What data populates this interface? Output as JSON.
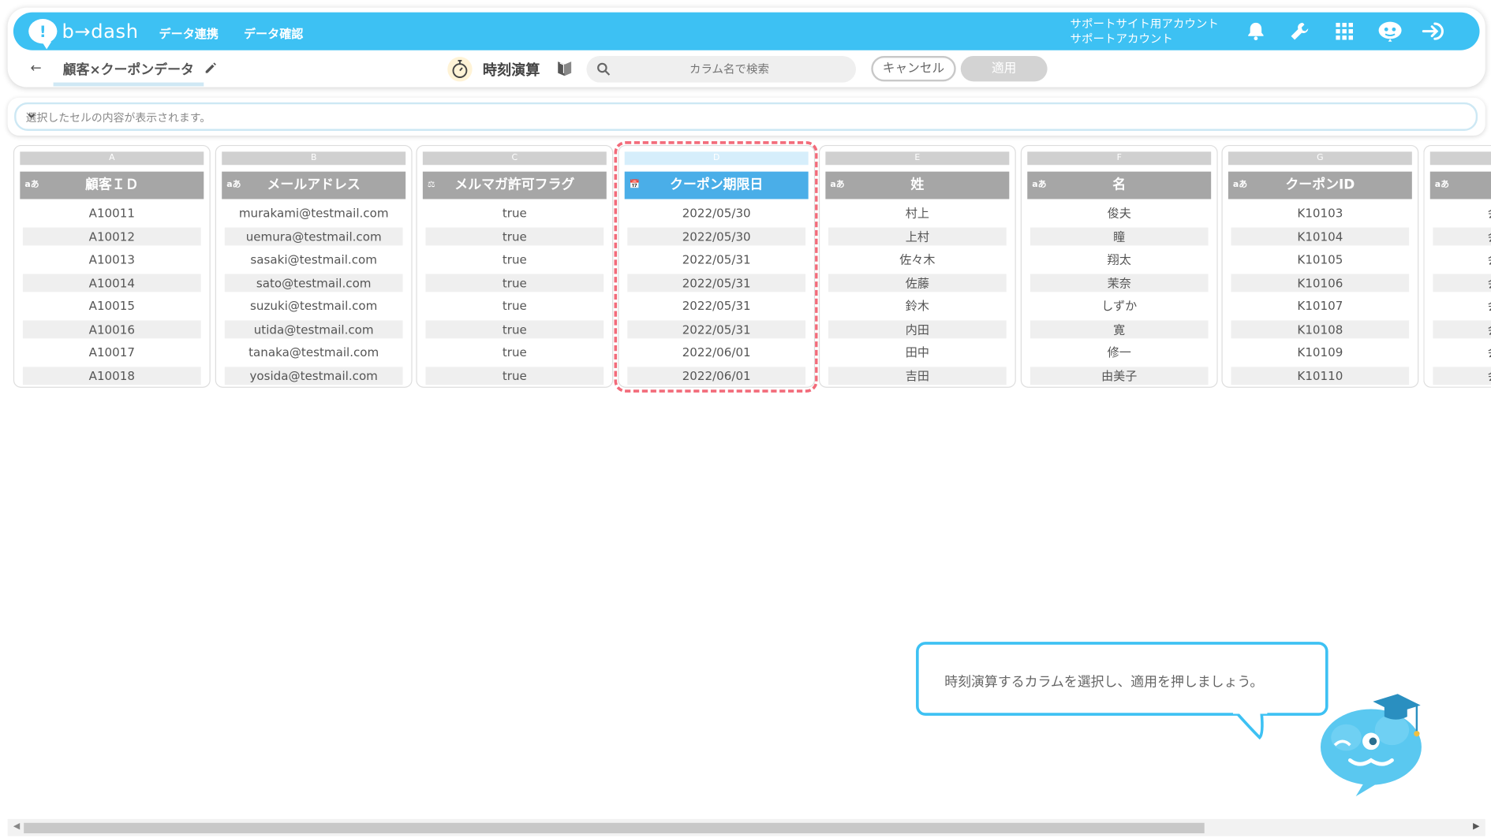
{
  "app": {
    "logo_mark": "!",
    "logo_text": "b→dash",
    "nav": [
      "データ連携",
      "データ確認"
    ],
    "account_line1": "サポートサイト用アカウント",
    "account_line2": "サポートアカウント",
    "icons": [
      "bell-icon",
      "wrench-icon",
      "grid-icon",
      "mascot-face-icon",
      "logout-icon"
    ]
  },
  "toolbar": {
    "back": "←",
    "dataset_name": "顧客×クーポンデータ",
    "operation_title": "時刻演算",
    "search_placeholder": "カラム名で検索",
    "cancel_label": "キャンセル",
    "apply_label": "適用"
  },
  "cell_preview": {
    "text": "選択したセルの内容が表示されます。"
  },
  "columns": [
    {
      "letter": "A",
      "type": "aあ",
      "name": "顧客ＩＤ",
      "selected": false,
      "values": [
        "A10011",
        "A10012",
        "A10013",
        "A10014",
        "A10015",
        "A10016",
        "A10017",
        "A10018"
      ]
    },
    {
      "letter": "B",
      "type": "aあ",
      "name": "メールアドレス",
      "selected": false,
      "values": [
        "murakami@testmail.com",
        "uemura@testmail.com",
        "sasaki@testmail.com",
        "sato@testmail.com",
        "suzuki@testmail.com",
        "utida@testmail.com",
        "tanaka@testmail.com",
        "yosida@testmail.com"
      ]
    },
    {
      "letter": "C",
      "type": "⚖",
      "name": "メルマガ許可フラグ",
      "selected": false,
      "values": [
        "true",
        "true",
        "true",
        "true",
        "true",
        "true",
        "true",
        "true"
      ]
    },
    {
      "letter": "D",
      "type": "📅",
      "name": "クーポン期限日",
      "selected": true,
      "values": [
        "2022/05/30",
        "2022/05/30",
        "2022/05/31",
        "2022/05/31",
        "2022/05/31",
        "2022/05/31",
        "2022/06/01",
        "2022/06/01"
      ]
    },
    {
      "letter": "E",
      "type": "aあ",
      "name": "姓",
      "selected": false,
      "values": [
        "村上",
        "上村",
        "佐々木",
        "佐藤",
        "鈴木",
        "内田",
        "田中",
        "吉田"
      ]
    },
    {
      "letter": "F",
      "type": "aあ",
      "name": "名",
      "selected": false,
      "values": [
        "俊夫",
        "瞳",
        "翔太",
        "茉奈",
        "しずか",
        "寛",
        "修一",
        "由美子"
      ]
    },
    {
      "letter": "G",
      "type": "aあ",
      "name": "クーポンID",
      "selected": false,
      "values": [
        "K10103",
        "K10104",
        "K10105",
        "K10106",
        "K10107",
        "K10108",
        "K10109",
        "K10110"
      ]
    },
    {
      "letter": "",
      "type": "aあ",
      "name": "",
      "selected": false,
      "values": [
        "会",
        "会",
        "会",
        "会",
        "会",
        "会",
        "会",
        "会"
      ]
    }
  ],
  "tooltip": {
    "text": "時刻演算するカラムを選択し、適用を押しましょう。"
  },
  "scrollbar": {
    "left_arrow": "◀",
    "right_arrow": "▶"
  },
  "colors": {
    "brand": "#3dc1f3",
    "selected_header": "#4aaee8",
    "highlight": "#f26b7a"
  }
}
